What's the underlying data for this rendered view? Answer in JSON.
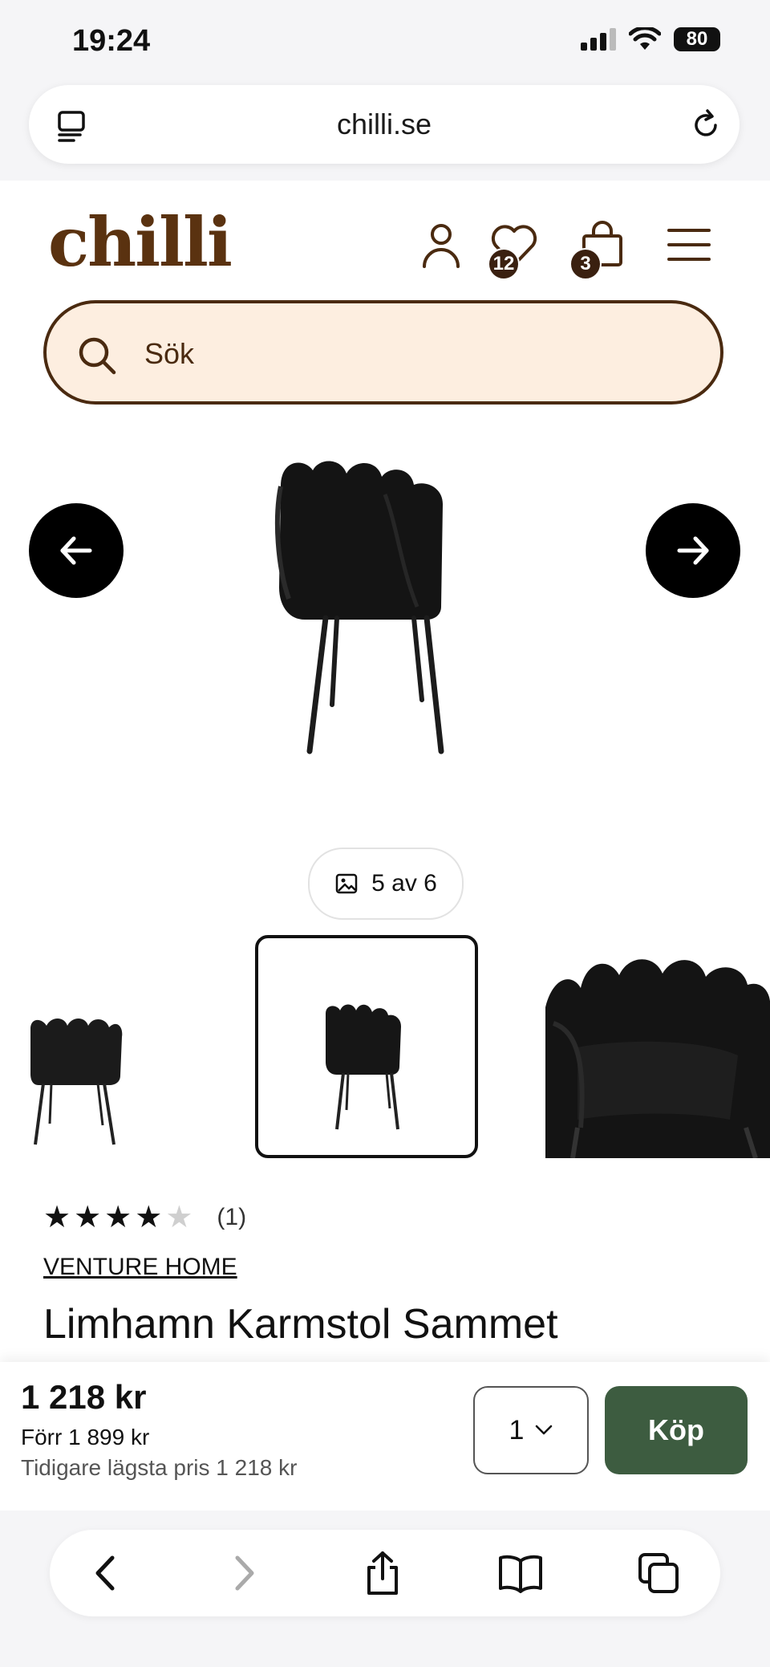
{
  "status_bar": {
    "time": "19:24",
    "battery": "80"
  },
  "browser": {
    "url": "chilli.se"
  },
  "header": {
    "logo": "chilli",
    "wishlist_count": "12",
    "cart_count": "3"
  },
  "search": {
    "placeholder": "Sök"
  },
  "gallery": {
    "counter": "5 av 6"
  },
  "product": {
    "rating_stars": 4,
    "rating_count": "(1)",
    "brand": "VENTURE HOME",
    "title": "Limhamn Karmstol Sammet"
  },
  "buy_bar": {
    "price": "1 218 kr",
    "price_before": "Förr 1 899 kr",
    "lowest_price": "Tidigare lägsta pris 1 218 kr",
    "quantity": "1",
    "buy_label": "Köp"
  },
  "colors": {
    "brand": "#5a3210",
    "search_bg": "#fdeee0",
    "buy_button": "#3d5c40"
  },
  "icons": [
    "tabs-icon",
    "reload-icon",
    "user-icon",
    "heart-icon",
    "bag-icon",
    "menu-icon",
    "search-icon",
    "arrow-left-icon",
    "arrow-right-icon",
    "image-icon",
    "chevron-down-icon",
    "back-icon",
    "forward-icon",
    "share-icon",
    "bookmarks-icon",
    "tabs-overview-icon"
  ]
}
